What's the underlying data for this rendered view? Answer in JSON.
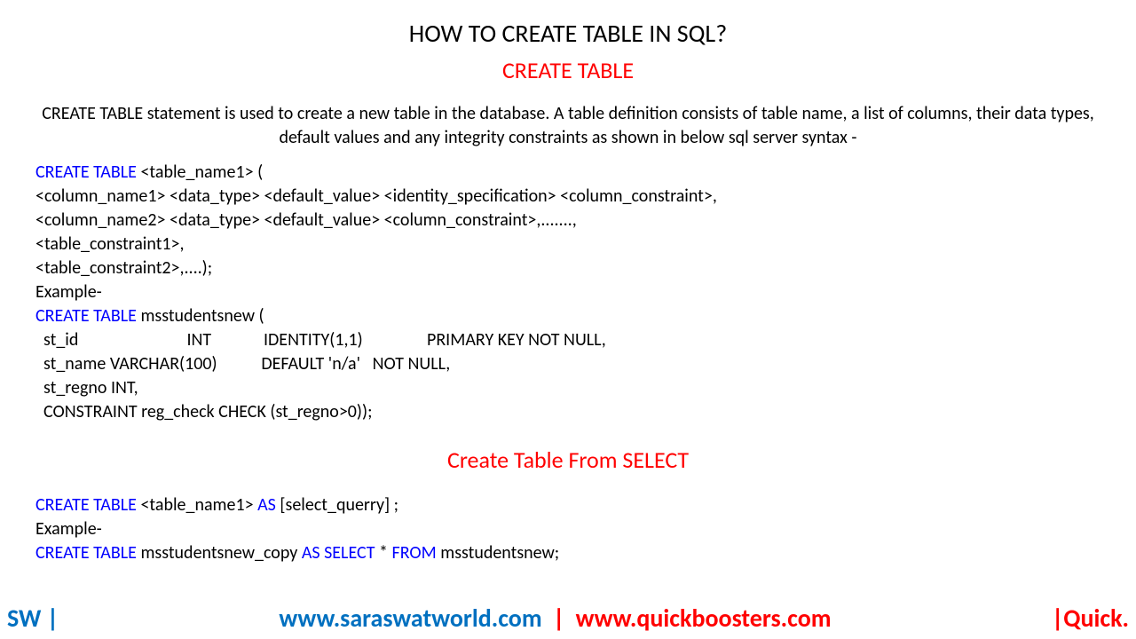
{
  "title": "HOW TO CREATE TABLE IN SQL?",
  "subtitle": "CREATE TABLE",
  "description": "CREATE TABLE statement is used to create a new table in the database. A table definition consists of table name, a list of columns, their data types, default values and any integrity constraints as shown in below sql server syntax -",
  "syntax": {
    "kw1": "CREATE TABLE ",
    "l1": "<table_name1> (",
    "l2": " <column_name1> <data_type> <default_value> <identity_specification> <column_constraint>,",
    "l3": " <column_name2> <data_type> <default_value> <column_constraint>,.......,",
    "l4": " <table_constraint1>,",
    "l5": " <table_constraint2>,....);"
  },
  "example_label": "Example-",
  "example1": {
    "kw1": "CREATE TABLE ",
    "l1": "msstudentsnew (",
    "l2": "  st_id                           INT             IDENTITY(1,1)                PRIMARY KEY NOT NULL,",
    "l3": "  st_name VARCHAR(100)           DEFAULT 'n/a'   NOT NULL,",
    "l4": "  st_regno INT,",
    "l5": "  CONSTRAINT reg_check CHECK (st_regno>0));"
  },
  "section2_title": "Create Table From SELECT",
  "syntax2": {
    "kw1": "CREATE TABLE ",
    "t1": "<table_name1> ",
    "kw2": "AS ",
    "t2": "[select_querry] ;"
  },
  "example2": {
    "kw1": "CREATE TABLE ",
    "t1": "msstudentsnew_copy ",
    "kw2": "AS SELECT ",
    "t2": "* ",
    "kw3": "FROM ",
    "t3": "msstudentsnew;"
  },
  "footer": {
    "left": "SW |",
    "url1": "www.saraswatworld.com",
    "sep": " | ",
    "url2": "www.quickboosters.com",
    "right": "|Quick."
  }
}
